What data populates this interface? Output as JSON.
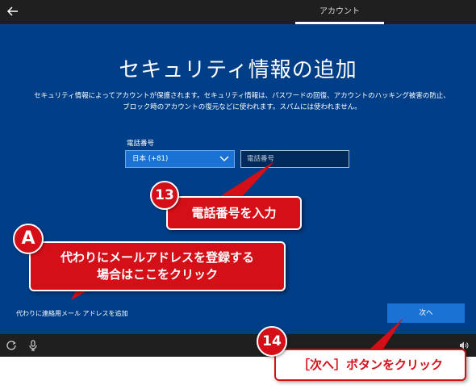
{
  "header": {
    "tab_label": "アカウント"
  },
  "page": {
    "title": "セキュリティ情報の追加",
    "description_line1": "セキュリティ情報によってアカウントが保護されます。セキュリティ情報は、パスワードの回復、アカウントのハッキング被害の防止、",
    "description_line2": "ブロック時のアカウントの復元などに使われます。スパムには使われません。"
  },
  "form": {
    "phone_label": "電話番号",
    "country_value": "日本 (+81)",
    "phone_placeholder": "電話番号"
  },
  "alt_link": "代わりに連絡用メール アドレスを追加",
  "next_button": "次へ",
  "annotations": {
    "badge_a": "A",
    "callout_a_line1": "代わりにメールアドレスを登録する",
    "callout_a_line2": "場合はここをクリック",
    "badge_13": "13",
    "callout_13": "電話番号を入力",
    "badge_14": "14",
    "callout_14": "［次へ］ボタンをクリック"
  },
  "colors": {
    "background_blue": "#003e88",
    "button_blue": "#1a73d4",
    "callout_red": "#d40f17"
  },
  "icons": [
    "back-arrow-icon",
    "chevron-down-icon",
    "ease-of-access-icon",
    "microphone-icon",
    "volume-icon"
  ]
}
